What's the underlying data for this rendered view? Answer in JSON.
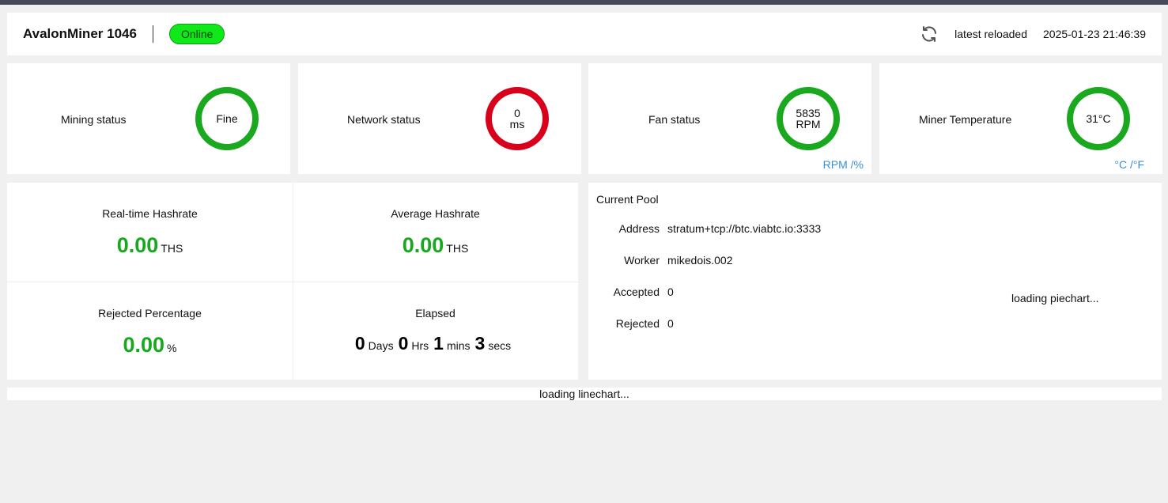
{
  "header": {
    "title": "AvalonMiner 1046",
    "status_badge": "Online",
    "reload_label": "latest reloaded",
    "reload_time": "2025-01-23 21:46:39"
  },
  "status_cards": [
    {
      "label": "Mining status",
      "gauge_line1": "Fine",
      "gauge_line2": "",
      "gauge_color": "#1aa81f"
    },
    {
      "label": "Network status",
      "gauge_line1": "0",
      "gauge_line2": "ms",
      "gauge_color": "#d9001b"
    },
    {
      "label": "Fan status",
      "gauge_line1": "5835",
      "gauge_line2": "RPM",
      "gauge_color": "#1aa81f",
      "unit_toggle": "RPM /%"
    },
    {
      "label": "Miner Temperature",
      "gauge_line1": "31°C",
      "gauge_line2": "",
      "gauge_color": "#1aa81f",
      "unit_toggle": "°C /°F"
    }
  ],
  "stats": {
    "realtime": {
      "title": "Real-time Hashrate",
      "value": "0.00",
      "unit": "THS"
    },
    "average": {
      "title": "Average Hashrate",
      "value": "0.00",
      "unit": "THS"
    },
    "rejected": {
      "title": "Rejected Percentage",
      "value": "0.00",
      "unit": "%"
    },
    "elapsed": {
      "title": "Elapsed",
      "days": "0",
      "days_unit": "Days",
      "hrs": "0",
      "hrs_unit": "Hrs",
      "mins": "1",
      "mins_unit": "mins",
      "secs": "3",
      "secs_unit": "secs"
    }
  },
  "pool": {
    "title": "Current Pool",
    "address_label": "Address",
    "address": "stratum+tcp://btc.viabtc.io:3333",
    "worker_label": "Worker",
    "worker": "mikedois.002",
    "accepted_label": "Accepted",
    "accepted": "0",
    "rejected_label": "Rejected",
    "rejected": "0",
    "piechart_loading": "loading piechart..."
  },
  "linechart_loading": "loading linechart...",
  "colors": {
    "accent_green": "#18a81d",
    "badge_green": "#10e81a",
    "alert_red": "#d9001b",
    "link_blue": "#3a8fd8"
  }
}
